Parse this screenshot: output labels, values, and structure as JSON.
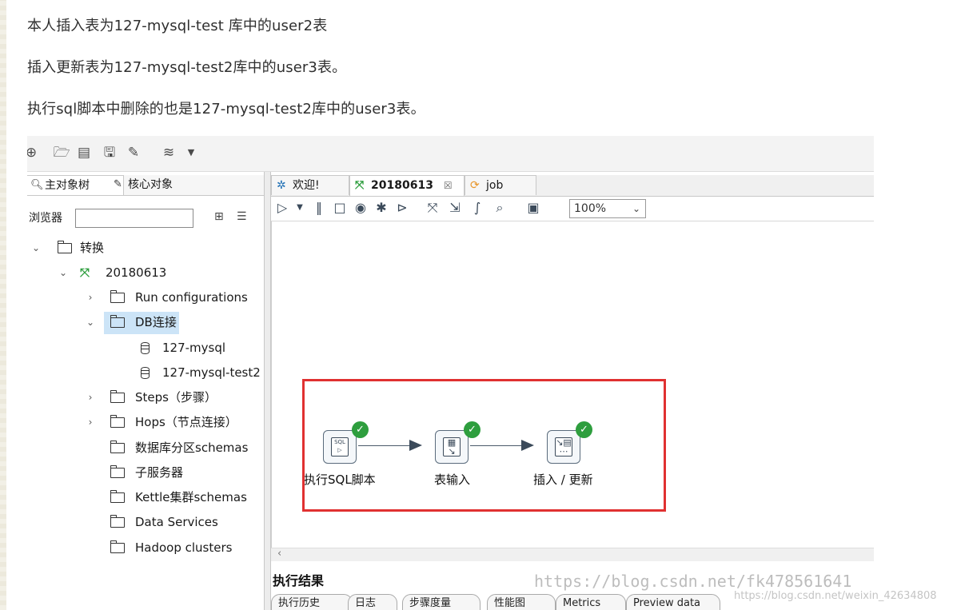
{
  "article": {
    "lines": [
      "本人插入表为127-mysql-test 库中的user2表",
      "插入更新表为127-mysql-test2库中的user3表。",
      "执行sql脚本中删除的也是127-mysql-test2库中的user3表。"
    ]
  },
  "left_panel": {
    "tabs": [
      "主对象树",
      "核心对象"
    ],
    "browser_label": "浏览器",
    "browser_input_value": "",
    "tree": {
      "root": "转换",
      "transformation": "20180613",
      "children": [
        "Run configurations",
        "DB连接",
        "Steps（步骤）",
        "Hops（节点连接）",
        "数据库分区schemas",
        "子服务器",
        "Kettle集群schemas",
        "Data Services",
        "Hadoop clusters"
      ],
      "db_connections": [
        "127-mysql",
        "127-mysql-test2"
      ]
    }
  },
  "editor": {
    "tabs": [
      {
        "label": "欢迎!",
        "icon": "kettle-welcome-icon"
      },
      {
        "label": "20180613",
        "icon": "transformation-icon",
        "closable": true
      },
      {
        "label": "job",
        "icon": "job-icon"
      }
    ],
    "zoom": "100%",
    "steps": [
      {
        "label": "执行SQL脚本",
        "icon": "sql-script-icon",
        "status": "ok"
      },
      {
        "label": "表输入",
        "icon": "table-input-icon",
        "status": "ok"
      },
      {
        "label": "插入 / 更新",
        "icon": "insert-update-icon",
        "status": "ok"
      }
    ],
    "results_title": "执行结果",
    "results_tabs": [
      "执行历史",
      "日志",
      "步骤度量",
      "性能图",
      "Metrics",
      "Preview data"
    ]
  },
  "watermarks": {
    "blog": "https://blog.csdn.net/fk478561641",
    "csdn": "https://blog.csdn.net/weixin_42634808"
  },
  "colors": {
    "highlight_box": "#e03131",
    "status_ok": "#2e9e3e",
    "selection": "#cce4f7"
  }
}
